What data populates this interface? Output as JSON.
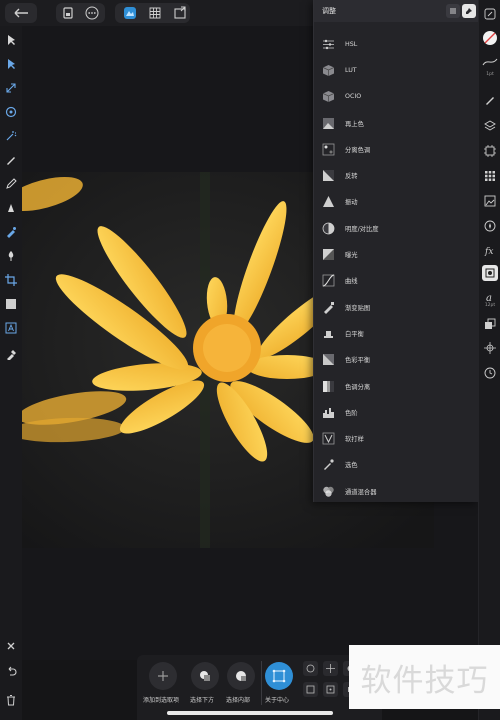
{
  "panel": {
    "title": "调整",
    "items": [
      {
        "label": "HSL",
        "icon": "hsl-sliders-icon"
      },
      {
        "label": "LUT",
        "icon": "lut-cube-icon"
      },
      {
        "label": "OCIO",
        "icon": "ocio-cube-icon"
      },
      {
        "label": "再上色",
        "icon": "recolor-icon"
      },
      {
        "label": "分离色调",
        "icon": "split-toning-icon"
      },
      {
        "label": "反转",
        "icon": "invert-icon"
      },
      {
        "label": "振动",
        "icon": "vibrance-icon"
      },
      {
        "label": "明度/对比度",
        "icon": "brightness-contrast-icon"
      },
      {
        "label": "曝光",
        "icon": "exposure-icon"
      },
      {
        "label": "曲线",
        "icon": "curves-icon"
      },
      {
        "label": "渐变贴图",
        "icon": "gradient-map-icon"
      },
      {
        "label": "白平衡",
        "icon": "white-balance-icon"
      },
      {
        "label": "色彩平衡",
        "icon": "color-balance-icon"
      },
      {
        "label": "色调分离",
        "icon": "posterize-icon"
      },
      {
        "label": "色阶",
        "icon": "levels-icon"
      },
      {
        "label": "软打样",
        "icon": "soft-proof-icon"
      },
      {
        "label": "选色",
        "icon": "selective-color-icon"
      },
      {
        "label": "通道混合器",
        "icon": "channel-mixer-icon"
      }
    ]
  },
  "bottom": {
    "actions": [
      {
        "label": "添加到选取项"
      },
      {
        "label": "选择下方"
      },
      {
        "label": "选择内部"
      },
      {
        "label": "关于中心"
      }
    ]
  },
  "rightbar": {
    "stroke_label": "1pt",
    "text_label": "12pt"
  },
  "watermark": "软件技巧",
  "colors": {
    "accent": "#2f8fd6",
    "petal": "#f5bd3a",
    "panel_bg": "#242428"
  }
}
